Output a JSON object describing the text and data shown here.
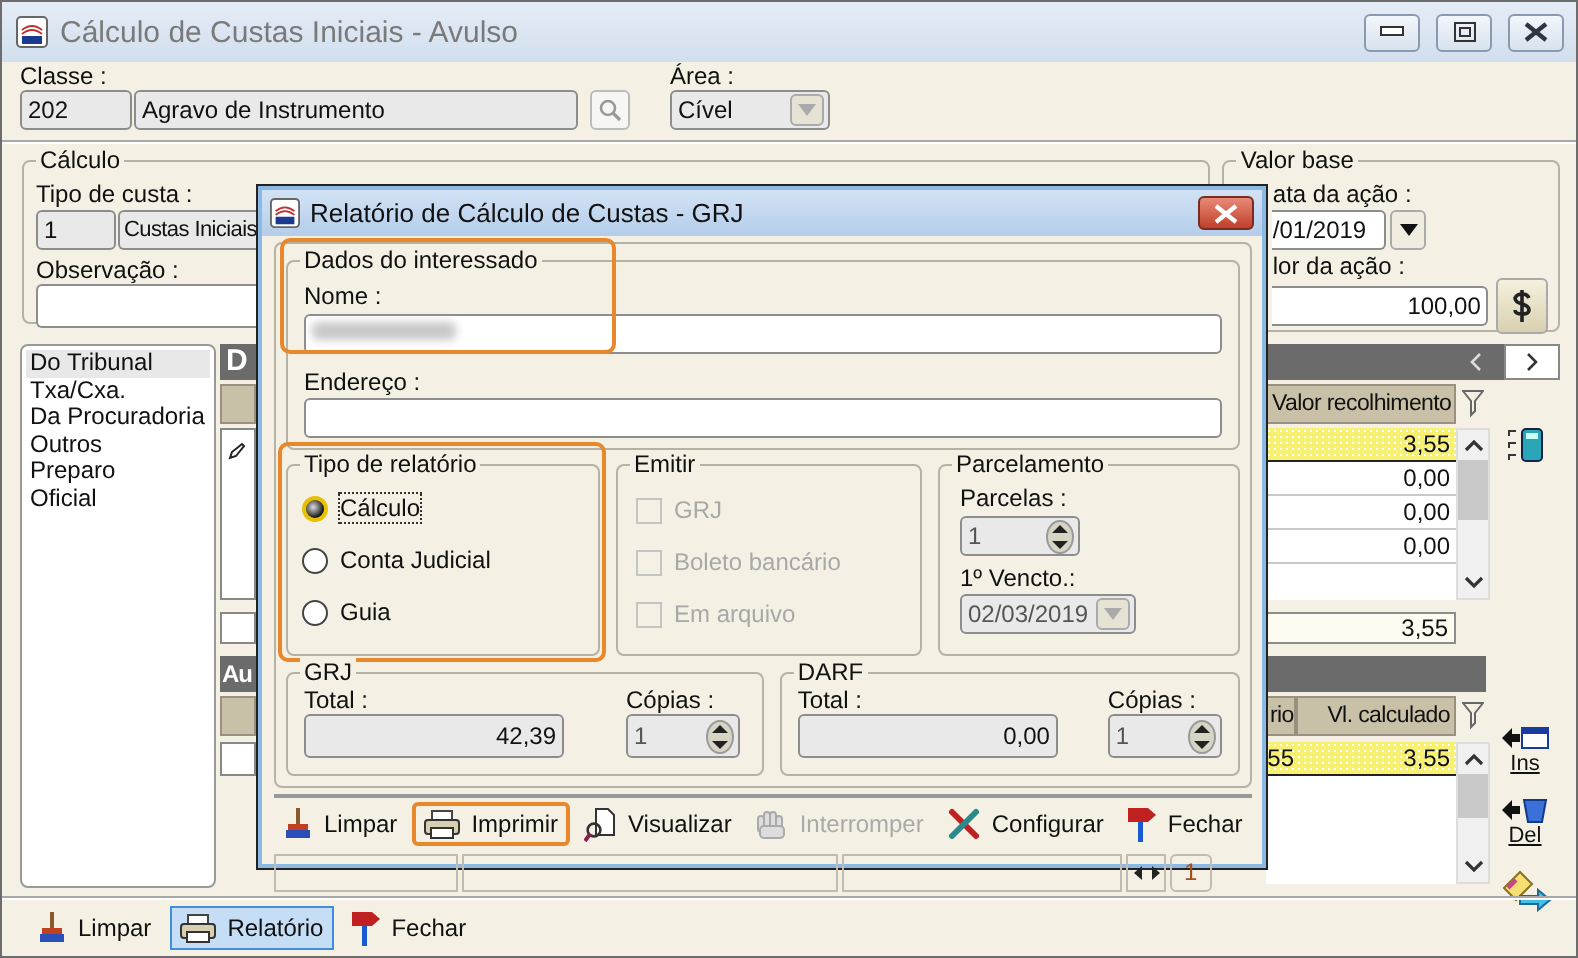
{
  "window": {
    "title": "Cálculo de Custas Iniciais - Avulso"
  },
  "classe": {
    "label": "Classe :",
    "code": "202",
    "name": "Agravo de Instrumento"
  },
  "area": {
    "label": "Área :",
    "value": "Cível"
  },
  "calculo": {
    "legend": "Cálculo",
    "tipo_label": "Tipo de custa :",
    "tipo_code": "1",
    "tipo_name": "Custas Iniciais",
    "observacao_label": "Observação :"
  },
  "valor_base": {
    "legend": "Valor base",
    "data_label": "ata da ação :",
    "data_value": "/01/2019",
    "valor_label": "lor da ação :",
    "valor_value": "100,00"
  },
  "categories": [
    {
      "label": "Do Tribunal",
      "selected": true
    },
    {
      "label": "Txa/Cxa.",
      "selected": false
    },
    {
      "label": "Da Procuradoria",
      "selected": false
    },
    {
      "label": "Outros",
      "selected": false
    },
    {
      "label": "Preparo",
      "selected": false
    },
    {
      "label": "Oficial",
      "selected": false
    }
  ],
  "grid_top": {
    "title": "D",
    "column": "Valor recolhimento",
    "rows": [
      {
        "value": "3,55",
        "selected": true
      },
      {
        "value": "0,00",
        "selected": false
      },
      {
        "value": "0,00",
        "selected": false
      },
      {
        "value": "0,00",
        "selected": false
      }
    ],
    "total": "3,55",
    "actions": [
      {
        "kind": "calculator"
      }
    ]
  },
  "grid_bottom": {
    "title": "Au",
    "columns": [
      "rio",
      "Vl. calculado"
    ],
    "rows": [
      {
        "cells": [
          "55",
          "3,55"
        ],
        "selected": true
      }
    ],
    "actions": [
      {
        "kind": "insert",
        "label": "Ins"
      },
      {
        "kind": "delete",
        "label": "Del"
      },
      {
        "kind": "export"
      }
    ]
  },
  "toolbar": [
    {
      "label": "Limpar",
      "kind": "clear",
      "selected": false
    },
    {
      "label": "Relatório",
      "kind": "print",
      "selected": true
    },
    {
      "label": "Fechar",
      "kind": "close",
      "selected": false
    }
  ],
  "dialog": {
    "title": "Relatório de Cálculo de Custas - GRJ",
    "interessado": {
      "legend": "Dados do interessado",
      "nome_label": "Nome :",
      "endereco_label": "Endereço :",
      "highlighted": true
    },
    "tipo": {
      "legend": "Tipo de relatório",
      "highlighted": true,
      "options": [
        {
          "label": "Cálculo",
          "selected": true
        },
        {
          "label": "Conta Judicial",
          "selected": false
        },
        {
          "label": "Guia",
          "selected": false
        }
      ]
    },
    "emitir": {
      "legend": "Emitir",
      "options": [
        {
          "label": "GRJ",
          "checked": false,
          "disabled": true
        },
        {
          "label": "Boleto bancário",
          "checked": false,
          "disabled": true
        },
        {
          "label": "Em arquivo",
          "checked": false,
          "disabled": true
        }
      ]
    },
    "parcelamento": {
      "legend": "Parcelamento",
      "parcelas_label": "Parcelas :",
      "parcelas": "1",
      "vencto_label": "1º Vencto.:",
      "vencto": "02/03/2019"
    },
    "grj": {
      "legend": "GRJ",
      "total_label": "Total :",
      "total": "42,39",
      "copias_label": "Cópias :",
      "copias": "1"
    },
    "darf": {
      "legend": "DARF",
      "total_label": "Total :",
      "total": "0,00",
      "copias_label": "Cópias :",
      "copias": "1"
    },
    "toolbar": [
      {
        "label": "Limpar",
        "kind": "clear",
        "disabled": false,
        "highlighted": false
      },
      {
        "label": "Imprimir",
        "kind": "print",
        "disabled": false,
        "highlighted": true
      },
      {
        "label": "Visualizar",
        "kind": "preview",
        "disabled": false,
        "highlighted": false
      },
      {
        "label": "Interromper",
        "kind": "stop",
        "disabled": true,
        "highlighted": false
      },
      {
        "label": "Configurar",
        "kind": "tools",
        "disabled": false,
        "highlighted": false
      },
      {
        "label": "Fechar",
        "kind": "close",
        "disabled": false,
        "highlighted": false
      }
    ],
    "status": {
      "page": "1"
    }
  }
}
